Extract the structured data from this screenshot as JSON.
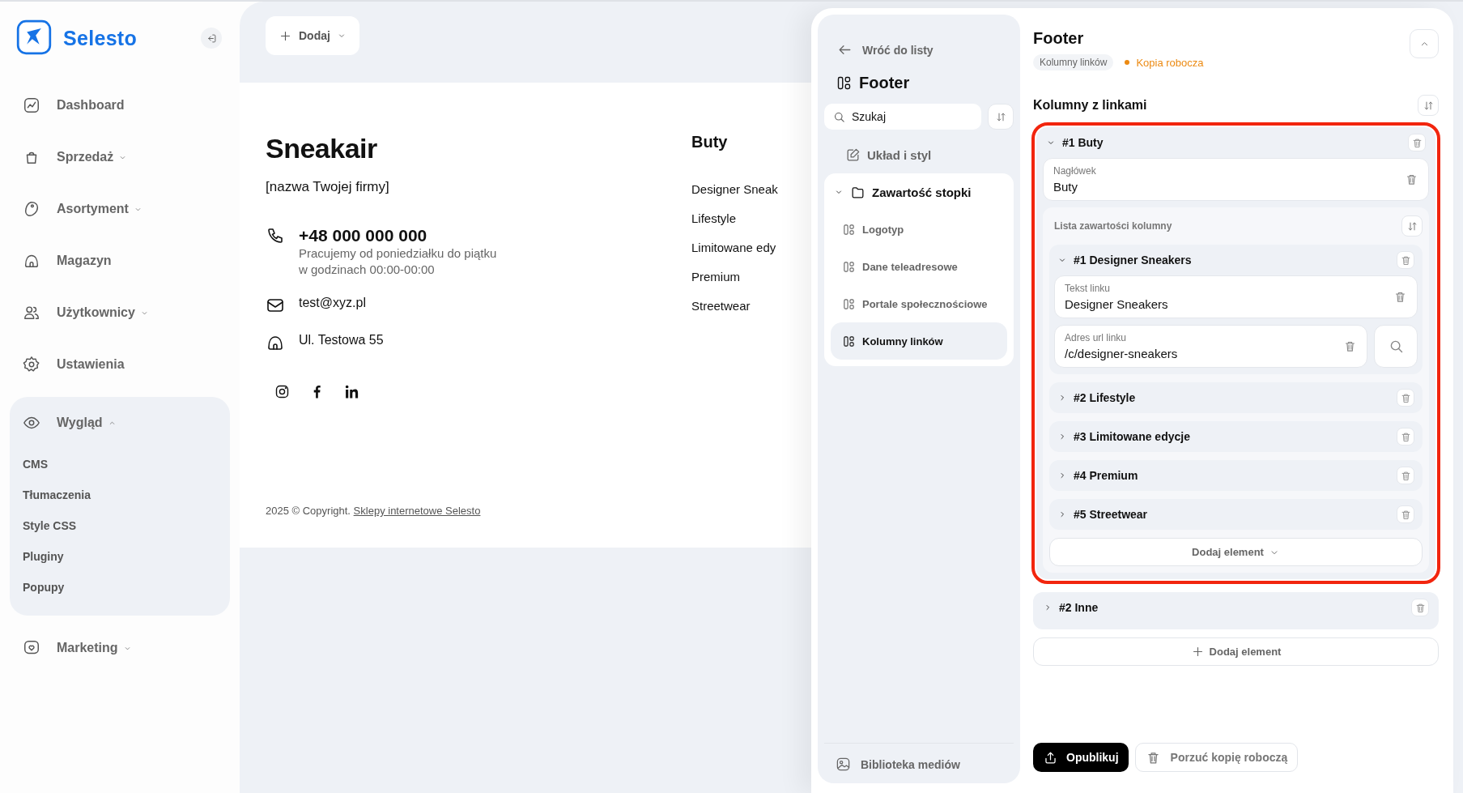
{
  "sidebar": {
    "brand": "Selesto",
    "items": [
      {
        "label": "Dashboard"
      },
      {
        "label": "Sprzedaż",
        "expanded": false
      },
      {
        "label": "Asortyment",
        "expanded": false
      },
      {
        "label": "Magazyn"
      },
      {
        "label": "Użytkownicy",
        "expanded": false
      },
      {
        "label": "Ustawienia"
      },
      {
        "label": "Wygląd",
        "expanded": true,
        "children": [
          {
            "label": "CMS"
          },
          {
            "label": "Tłumaczenia"
          },
          {
            "label": "Style CSS"
          },
          {
            "label": "Pluginy"
          },
          {
            "label": "Popupy"
          }
        ]
      },
      {
        "label": "Marketing",
        "expanded": false
      }
    ]
  },
  "preview": {
    "add_button": "Dodaj",
    "brand": "Sneakair",
    "tagline": "[nazwa Twojej firmy]",
    "phone": "+48 000 000 000",
    "hours": [
      "Pracujemy od poniedziałku do piątku",
      "w godzinach 00:00-00:00"
    ],
    "email": "test@xyz.pl",
    "address": "Ul. Testowa 55",
    "column_title": "Buty",
    "links": [
      "Designer Sneak",
      "Lifestyle",
      "Limitowane edy",
      "Premium",
      "Streetwear"
    ],
    "copyright": "2025 © Copyright.",
    "copyright_link": "Sklepy internetowe Selesto"
  },
  "nav": {
    "back": "Wróć do listy",
    "title": "Footer",
    "search": {
      "placeholder": "Szukaj"
    },
    "items": [
      {
        "label": "Układ i styl",
        "selected": false
      },
      {
        "label": "Zawartość stopki",
        "selected": false,
        "expanded": true,
        "children": [
          {
            "label": "Logotyp",
            "selected": false
          },
          {
            "label": "Dane teleadresowe",
            "selected": false
          },
          {
            "label": "Portale społecznościowe",
            "selected": false
          },
          {
            "label": "Kolumny linków",
            "selected": true
          }
        ]
      }
    ],
    "media_library": "Biblioteka mediów"
  },
  "editor": {
    "title": "Footer",
    "breadcrumb": "Kolumny linków",
    "status": "Kopia robocza",
    "section_title": "Kolumny z linkami",
    "columns": [
      {
        "title": "#1 Buty",
        "expanded": true,
        "highlighted": true,
        "heading": {
          "label": "Nagłówek",
          "value": "Buty"
        },
        "list_label": "Lista zawartości kolumny",
        "items": [
          {
            "title": "#1 Designer Sneakers",
            "expanded": true,
            "fields": [
              {
                "label": "Tekst linku",
                "value": "Designer Sneakers"
              },
              {
                "label": "Adres url linku",
                "value": "/c/designer-sneakers"
              }
            ]
          },
          {
            "title": "#2 Lifestyle",
            "expanded": false
          },
          {
            "title": "#3 Limitowane edycje",
            "expanded": false
          },
          {
            "title": "#4 Premium",
            "expanded": false
          },
          {
            "title": "#5 Streetwear",
            "expanded": false
          }
        ],
        "add_button": "Dodaj element"
      },
      {
        "title": "#2 Inne",
        "expanded": false,
        "highlighted": false
      }
    ],
    "add_button": "Dodaj element",
    "publish_button": "Opublikuj",
    "discard_button": "Porzuć kopię roboczą"
  }
}
